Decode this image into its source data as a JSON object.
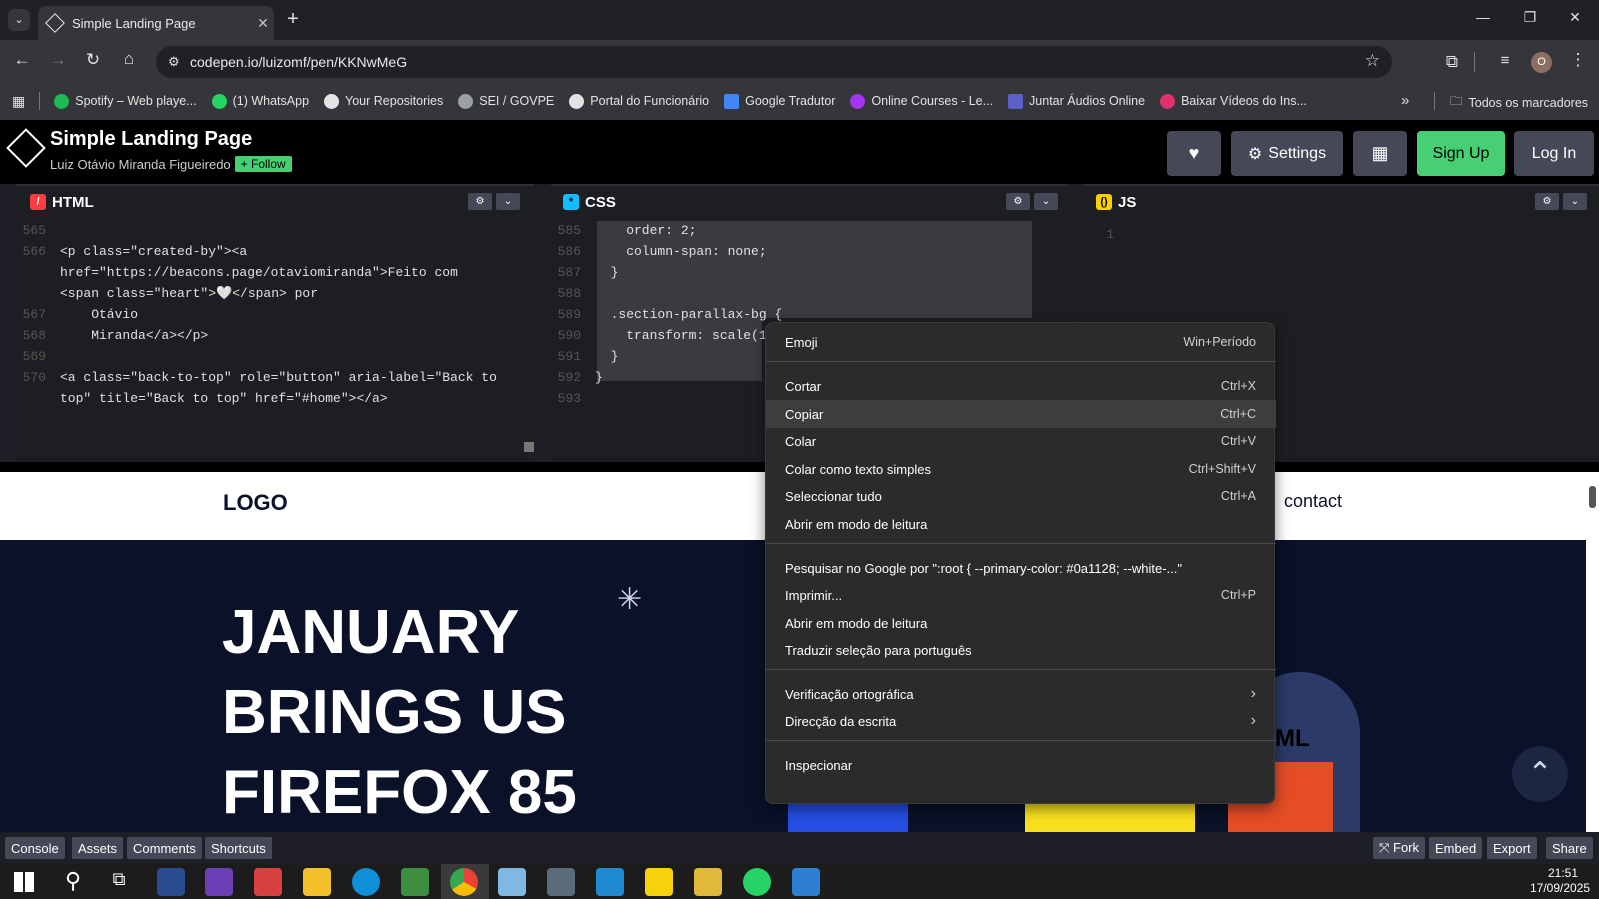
{
  "browser": {
    "tab_title": "Simple Landing Page",
    "url": "codepen.io/luizomf/pen/KKNwMeG",
    "profile_initial": "O",
    "bookmarks": [
      "Spotify – Web playe...",
      "(1) WhatsApp",
      "Your Repositories",
      "SEI / GOVPE",
      "Portal do Funcionário",
      "Google Tradutor",
      "Online Courses - Le...",
      "Juntar Áudios Online",
      "Baixar Vídeos do Ins..."
    ],
    "all_bookmarks": "Todos os marcadores",
    "more_bookmarks": "»"
  },
  "codepen": {
    "title": "Simple Landing Page",
    "author": "Luiz Otávio Miranda Figueiredo",
    "follow": "+ Follow",
    "settings": "Settings",
    "signup": "Sign Up",
    "login": "Log In"
  },
  "editors": {
    "html": {
      "label": "HTML",
      "lines": [
        {
          "n": "565",
          "t": ""
        },
        {
          "n": "566",
          "t": "<p class=\"created-by\"><a"
        },
        {
          "n": "",
          "t": "href=\"https://beacons.page/otaviomiranda\">Feito com"
        },
        {
          "n": "",
          "t": "<span class=\"heart\">🤍</span> por"
        },
        {
          "n": "567",
          "t": "    Otávio"
        },
        {
          "n": "568",
          "t": "    Miranda</a></p>"
        },
        {
          "n": "569",
          "t": ""
        },
        {
          "n": "570",
          "t": "<a class=\"back-to-top\" role=\"button\" aria-label=\"Back to"
        },
        {
          "n": "",
          "t": "top\" title=\"Back to top\" href=\"#home\"></a>"
        }
      ]
    },
    "css": {
      "label": "CSS",
      "lines": [
        {
          "n": "585",
          "t": "    order: 2;"
        },
        {
          "n": "586",
          "t": "    column-span: none;"
        },
        {
          "n": "587",
          "t": "  }"
        },
        {
          "n": "588",
          "t": ""
        },
        {
          "n": "589",
          "t": "  .section-parallax-bg {"
        },
        {
          "n": "590",
          "t": "    transform: scale(1"
        },
        {
          "n": "591",
          "t": "  }"
        },
        {
          "n": "592",
          "t": "}"
        },
        {
          "n": "593",
          "t": ""
        }
      ]
    },
    "js": {
      "label": "JS",
      "lines": [
        {
          "n": "1",
          "t": ""
        }
      ]
    }
  },
  "preview": {
    "logo": "LOGO",
    "nav_contact": "contact",
    "hero": [
      "JANUARY",
      "BRINGS US",
      "FIREFOX 85"
    ],
    "html_badge": "ML"
  },
  "context_menu": [
    {
      "label": "Emoji",
      "shortcut": "Win+Período"
    },
    {
      "label": "Cortar",
      "shortcut": "Ctrl+X"
    },
    {
      "label": "Copiar",
      "shortcut": "Ctrl+C"
    },
    {
      "label": "Colar",
      "shortcut": "Ctrl+V"
    },
    {
      "label": "Colar como texto simples",
      "shortcut": "Ctrl+Shift+V"
    },
    {
      "label": "Seleccionar tudo",
      "shortcut": "Ctrl+A"
    },
    {
      "label": "Abrir em modo de leitura",
      "shortcut": ""
    },
    {
      "label": "Pesquisar no Google por \":root {   --primary-color: #0a1128;   --white-...\"",
      "shortcut": ""
    },
    {
      "label": "Imprimir...",
      "shortcut": "Ctrl+P"
    },
    {
      "label": "Abrir em modo de leitura",
      "shortcut": ""
    },
    {
      "label": "Traduzir seleção para português",
      "shortcut": ""
    },
    {
      "label": "Verificação ortográfica",
      "shortcut": "›"
    },
    {
      "label": "Direcção da escrita",
      "shortcut": "›"
    },
    {
      "label": "Inspecionar",
      "shortcut": ""
    }
  ],
  "footer": {
    "left": [
      "Console",
      "Assets",
      "Comments",
      "Shortcuts"
    ],
    "right": [
      "⤧ Fork",
      "Embed",
      "Export",
      "Share"
    ]
  },
  "taskbar": {
    "time": "21:51",
    "date": "17/09/2025"
  }
}
